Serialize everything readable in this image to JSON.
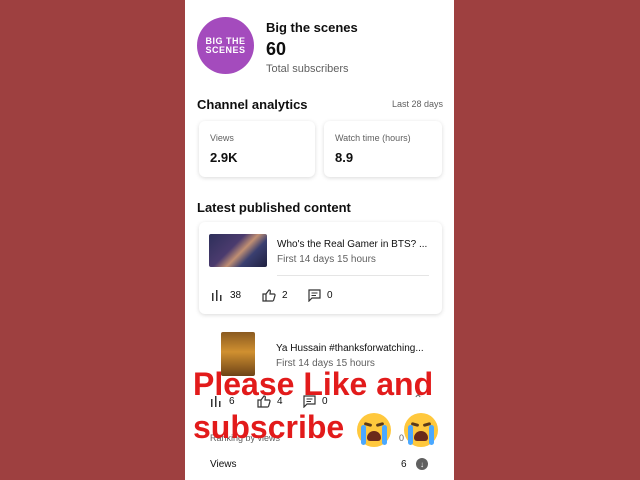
{
  "channel": {
    "avatar_text": [
      "BIG THE",
      "SCENES"
    ],
    "name": "Big the scenes",
    "subscribers": "60",
    "subscribers_label": "Total subscribers"
  },
  "analytics": {
    "title": "Channel analytics",
    "period": "Last 28 days",
    "views_label": "Views",
    "views_value": "2.9K",
    "watch_label": "Watch time (hours)",
    "watch_value": "8.9"
  },
  "latest": {
    "title": "Latest published content",
    "videos": [
      {
        "title": "Who's the Real Gamer in BTS? ...",
        "subtitle": "First 14 days 15 hours",
        "views": "38",
        "likes": "2",
        "comments": "0"
      },
      {
        "title": "Ya Hussain #thanksforwatching...",
        "subtitle": "First 14 days 15 hours",
        "views": "6",
        "likes": "4",
        "comments": "0"
      }
    ],
    "ranking_label": "Ranking by views",
    "ranking_value": "0",
    "views_row_label": "Views",
    "views_row_value": "6"
  },
  "overlay": {
    "line1": "Please Like and",
    "line2": "subscribe"
  },
  "colors": {
    "background": "#9e4040",
    "overlay_text": "#e21b1b",
    "avatar": "#a44bbd"
  }
}
